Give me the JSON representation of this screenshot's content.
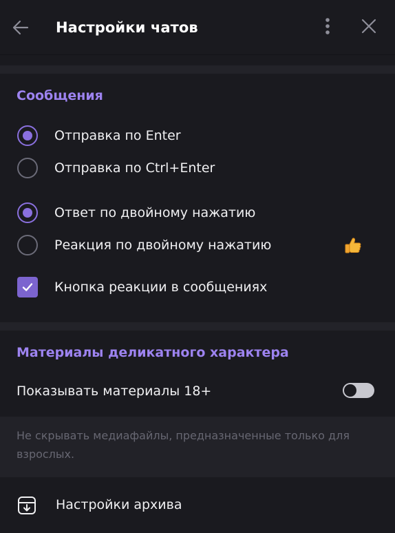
{
  "header": {
    "title": "Настройки чатов",
    "back_icon": "arrow-left-icon",
    "more_icon": "more-vertical-icon",
    "close_icon": "close-icon"
  },
  "messages_section": {
    "title": "Сообщения",
    "send_options": [
      {
        "label": "Отправка по Enter",
        "selected": true
      },
      {
        "label": "Отправка по Ctrl+Enter",
        "selected": false
      }
    ],
    "double_tap_options": [
      {
        "label": "Ответ по двойному нажатию",
        "selected": true
      },
      {
        "label": "Реакция по двойному нажатию",
        "selected": false,
        "emoji_icon": "thumbs-up-icon"
      }
    ],
    "reaction_button": {
      "label": "Кнопка реакции в сообщениях",
      "checked": true
    }
  },
  "sensitive_section": {
    "title": "Материалы деликатного характера",
    "toggle": {
      "label": "Показывать материалы 18+",
      "enabled": false
    },
    "hint": "Не скрывать медиафайлы, предназначенные только для взрослых."
  },
  "archive": {
    "label": "Настройки архива",
    "icon": "archive-box-icon"
  },
  "colors": {
    "background": "#1a1a1f",
    "accent": "#8a70de",
    "section_title": "#9d83f0",
    "hint_text": "#676772"
  }
}
